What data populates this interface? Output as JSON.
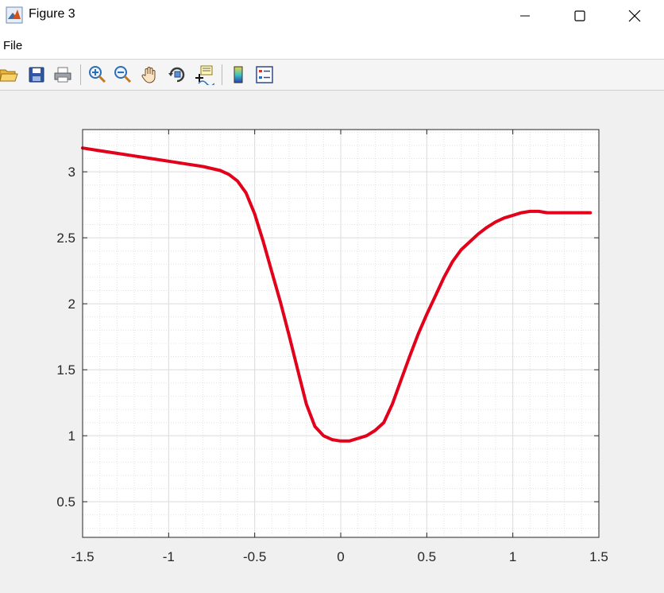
{
  "window": {
    "title": "Figure 3",
    "icon": "matlab-icon",
    "controls": [
      "minimize-icon",
      "maximize-icon",
      "close-icon"
    ]
  },
  "menu": {
    "file_label": "File"
  },
  "toolbar": {
    "buttons": [
      "open-folder-icon",
      "save-icon",
      "print-icon",
      "zoom-in-icon",
      "zoom-out-icon",
      "pan-icon",
      "rotate-3d-icon",
      "data-cursor-icon",
      "colorbar-icon",
      "legend-icon"
    ]
  },
  "colors": {
    "curve": "#e3001b",
    "background": "#f0f0f0",
    "axes_background": "#ffffff"
  },
  "chart_data": {
    "type": "line",
    "title": "",
    "xlabel": "",
    "ylabel": "",
    "xlim": [
      -1.5,
      1.5
    ],
    "ylim": [
      0.23,
      3.32
    ],
    "xticks": [
      -1.5,
      -1,
      -0.5,
      0,
      0.5,
      1,
      1.5
    ],
    "yticks": [
      0.5,
      1,
      1.5,
      2,
      2.5,
      3
    ],
    "xtick_labels": [
      "-1.5",
      "-1",
      "-0.5",
      "0",
      "0.5",
      "1",
      "1.5"
    ],
    "ytick_labels": [
      "0.5",
      "1",
      "1.5",
      "2",
      "2.5",
      "3"
    ],
    "grid": "on",
    "minor_grid": "on",
    "series": [
      {
        "color": "#e3001b",
        "x": [
          -1.5,
          -1.4,
          -1.3,
          -1.2,
          -1.1,
          -1.0,
          -0.9,
          -0.8,
          -0.7,
          -0.65,
          -0.6,
          -0.55,
          -0.5,
          -0.45,
          -0.4,
          -0.35,
          -0.3,
          -0.25,
          -0.2,
          -0.15,
          -0.1,
          -0.05,
          0.0,
          0.05,
          0.1,
          0.15,
          0.2,
          0.25,
          0.3,
          0.35,
          0.4,
          0.45,
          0.5,
          0.55,
          0.6,
          0.65,
          0.7,
          0.75,
          0.8,
          0.85,
          0.9,
          0.95,
          1.0,
          1.05,
          1.1,
          1.15,
          1.2,
          1.3,
          1.4,
          1.45
        ],
        "y": [
          3.18,
          3.16,
          3.14,
          3.12,
          3.1,
          3.08,
          3.06,
          3.04,
          3.01,
          2.98,
          2.93,
          2.84,
          2.68,
          2.47,
          2.24,
          2.01,
          1.76,
          1.5,
          1.24,
          1.07,
          1.0,
          0.97,
          0.96,
          0.96,
          0.98,
          1.0,
          1.04,
          1.1,
          1.24,
          1.42,
          1.6,
          1.77,
          1.92,
          2.06,
          2.2,
          2.32,
          2.41,
          2.47,
          2.53,
          2.58,
          2.62,
          2.65,
          2.67,
          2.69,
          2.7,
          2.7,
          2.69,
          2.69,
          2.69,
          2.69
        ]
      }
    ]
  }
}
